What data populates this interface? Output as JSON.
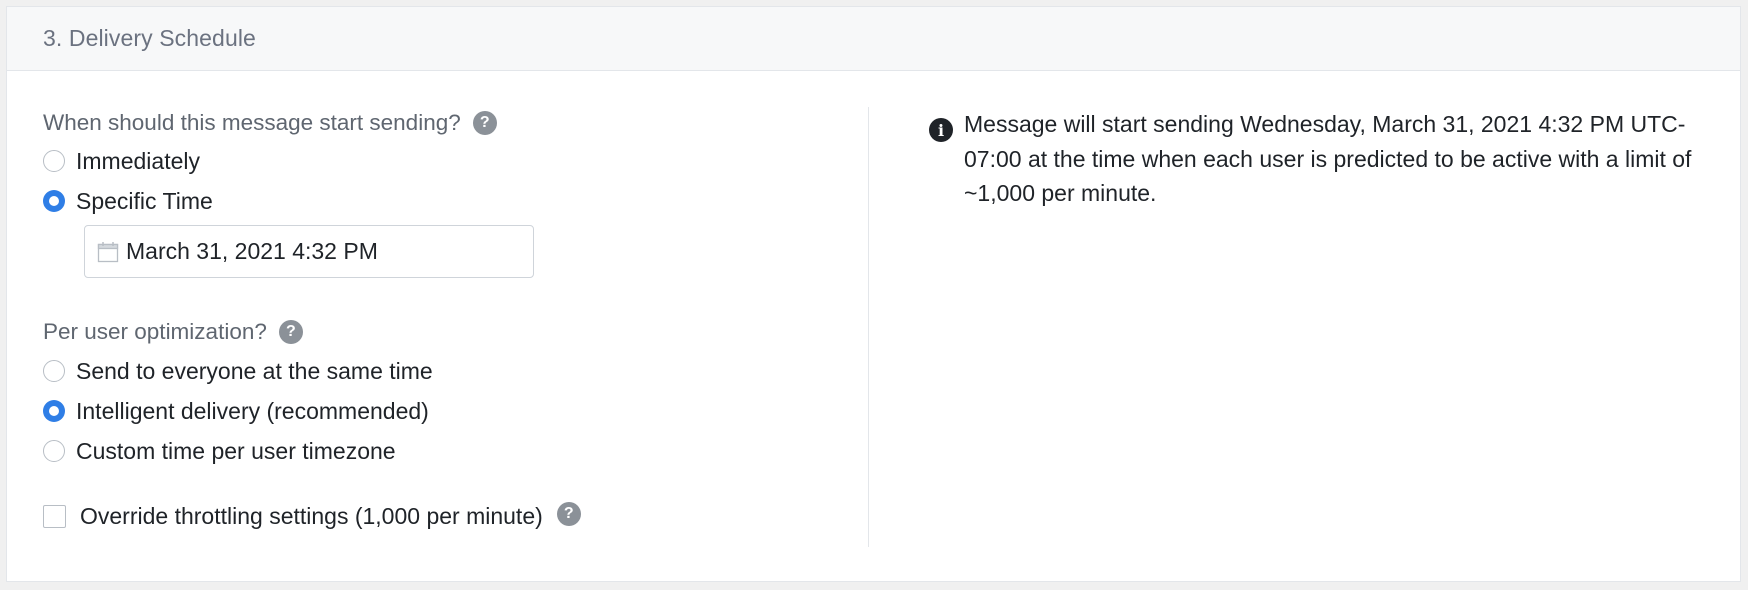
{
  "section": {
    "title": "3. Delivery Schedule"
  },
  "start_sending": {
    "question": "When should this message start sending?",
    "help_icon": "question-circle-icon",
    "options": [
      {
        "label": "Immediately",
        "selected": false
      },
      {
        "label": "Specific Time",
        "selected": true
      }
    ],
    "datetime_value": "March 31, 2021 4:32 PM",
    "datetime_icon": "calendar-icon"
  },
  "optimization": {
    "question": "Per user optimization?",
    "help_icon": "question-circle-icon",
    "options": [
      {
        "label": "Send to everyone at the same time",
        "selected": false
      },
      {
        "label": "Intelligent delivery (recommended)",
        "selected": true
      },
      {
        "label": "Custom time per user timezone",
        "selected": false
      }
    ]
  },
  "throttling": {
    "label": "Override throttling settings (1,000 per minute)",
    "checked": false,
    "help_icon": "question-circle-icon"
  },
  "summary": {
    "icon": "info-circle-icon",
    "text": "Message will start sending Wednesday, March 31, 2021 4:32 PM UTC-07:00 at the time when each user is predicted to be active with a limit of ~1,000 per minute."
  },
  "colors": {
    "accent": "#2f7ee6",
    "help_icon_bg": "#8b9198",
    "header_bg": "#f7f8f9"
  }
}
